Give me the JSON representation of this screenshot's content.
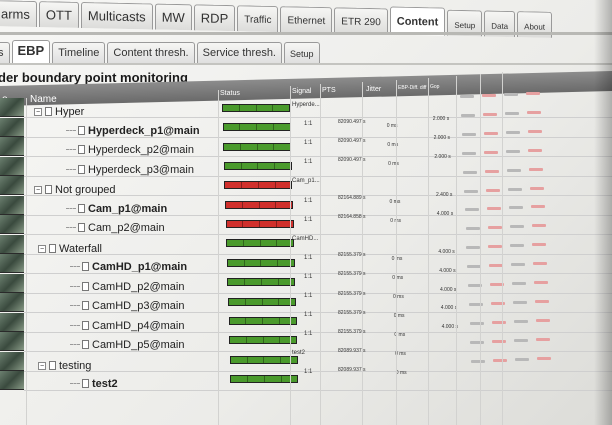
{
  "top_tabs": [
    {
      "label": "arms",
      "active": false
    },
    {
      "label": "OTT",
      "active": false
    },
    {
      "label": "Multicasts",
      "active": false
    },
    {
      "label": "MW",
      "active": false
    },
    {
      "label": "RDP",
      "active": false
    },
    {
      "label": "Traffic",
      "active": false
    },
    {
      "label": "Ethernet",
      "active": false
    },
    {
      "label": "ETR 290",
      "active": false
    },
    {
      "label": "Content",
      "active": true
    },
    {
      "label": "Setup",
      "active": false
    },
    {
      "label": "Data",
      "active": false
    },
    {
      "label": "About",
      "active": false
    }
  ],
  "sub_tabs": [
    {
      "label": "s",
      "active": false
    },
    {
      "label": "EBP",
      "active": true
    },
    {
      "label": "Timeline",
      "active": false
    },
    {
      "label": "Content thresh.",
      "active": false
    },
    {
      "label": "Service thresh.",
      "active": false
    },
    {
      "label": "Setup",
      "active": false
    }
  ],
  "page_title": "der boundary point monitoring",
  "columns": {
    "thumb": "o",
    "name": "Name",
    "status": "Status",
    "signal": "Signal",
    "pts": "PTS",
    "jitter": "Jitter",
    "ebp_diff": "EBP-Diff. diff",
    "gop": "Gop"
  },
  "rows": [
    {
      "name": "Hyper",
      "type": "group",
      "level": 0,
      "status": "green",
      "signal": "Hyperde...",
      "pts": "",
      "jitter": "",
      "num": "",
      "has_thumb": true
    },
    {
      "name": "Hyperdeck_p1@main",
      "type": "item",
      "level": 1,
      "bold": true,
      "status": "green",
      "signal": "1:1",
      "pts": "82090.497 s",
      "jitter": "0 ms",
      "num": "2.000 s",
      "has_thumb": true
    },
    {
      "name": "Hyperdeck_p2@main",
      "type": "item",
      "level": 1,
      "status": "green",
      "signal": "1:1",
      "pts": "82090.497 s",
      "jitter": "0 ms",
      "num": "2.000 s",
      "has_thumb": true
    },
    {
      "name": "Hyperdeck_p3@main",
      "type": "item",
      "level": 1,
      "status": "green",
      "signal": "1:1",
      "pts": "82090.497 s",
      "jitter": "0 ms",
      "num": "2.000 s",
      "has_thumb": true
    },
    {
      "name": "Not grouped",
      "type": "group",
      "level": 0,
      "status": "red",
      "signal": "Cam_p1...",
      "pts": "",
      "jitter": "",
      "num": "",
      "has_thumb": true
    },
    {
      "name": "Cam_p1@main",
      "type": "item",
      "level": 1,
      "bold": true,
      "status": "red",
      "signal": "1:1",
      "pts": "82164.889 s",
      "jitter": "0 ms",
      "num": "2.400 s",
      "has_thumb": true
    },
    {
      "name": "Cam_p2@main",
      "type": "item",
      "level": 1,
      "status": "red",
      "signal": "1:1",
      "pts": "82164.858 s",
      "jitter": "0 ms",
      "num": "4.000 s",
      "has_thumb": true
    },
    {
      "name": "Waterfall",
      "type": "group",
      "level": 0,
      "status": "green",
      "signal": "CamHD...",
      "pts": "",
      "jitter": "",
      "num": "",
      "has_thumb": true
    },
    {
      "name": "CamHD_p1@main",
      "type": "item",
      "level": 1,
      "bold": true,
      "status": "green",
      "signal": "1:1",
      "pts": "82155.379 s",
      "jitter": "0 ms",
      "num": "4.000 s",
      "has_thumb": true
    },
    {
      "name": "CamHD_p2@main",
      "type": "item",
      "level": 1,
      "status": "green",
      "signal": "1:1",
      "pts": "82155.379 s",
      "jitter": "0 ms",
      "num": "4.000 s",
      "has_thumb": true
    },
    {
      "name": "CamHD_p3@main",
      "type": "item",
      "level": 1,
      "status": "green",
      "signal": "1:1",
      "pts": "82155.379 s",
      "jitter": "0 ms",
      "num": "4.000 s",
      "has_thumb": true
    },
    {
      "name": "CamHD_p4@main",
      "type": "item",
      "level": 1,
      "status": "green",
      "signal": "1:1",
      "pts": "82155.379 s",
      "jitter": "0 ms",
      "num": "4.000 s",
      "has_thumb": true
    },
    {
      "name": "CamHD_p5@main",
      "type": "item",
      "level": 1,
      "status": "green",
      "signal": "1:1",
      "pts": "82155.379 s",
      "jitter": "0 ms",
      "num": "4.000 s",
      "has_thumb": true
    },
    {
      "name": "testing",
      "type": "group",
      "level": 0,
      "status": "green",
      "signal": "test2",
      "pts": "82089.937 s",
      "jitter": "0 ms",
      "num": "",
      "has_thumb": true
    },
    {
      "name": "test2",
      "type": "item",
      "level": 1,
      "bold": true,
      "status": "green",
      "signal": "1:1",
      "pts": "82089.937 s",
      "jitter": "0 ms",
      "num": "",
      "has_thumb": true
    }
  ],
  "colors": {
    "ok": "#4a9a2c",
    "alarm": "#d0302c",
    "header": "#7a7a7a"
  }
}
